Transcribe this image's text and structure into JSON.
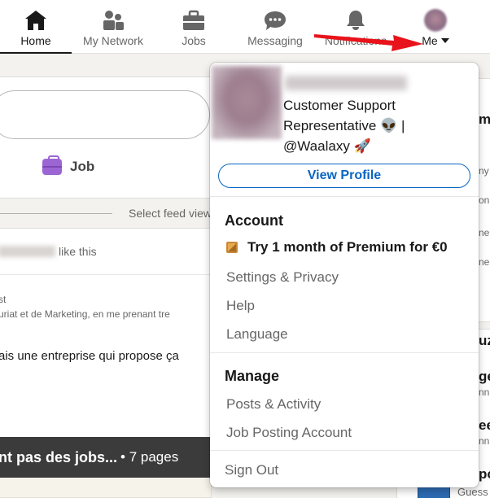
{
  "nav": {
    "items": [
      {
        "label": "Home",
        "icon": "home-icon"
      },
      {
        "label": "My Network",
        "icon": "network-icon"
      },
      {
        "label": "Jobs",
        "icon": "briefcase-icon"
      },
      {
        "label": "Messaging",
        "icon": "message-icon"
      },
      {
        "label": "Notifications",
        "icon": "bell-icon"
      }
    ],
    "me_label": "Me",
    "active": "Home"
  },
  "feed": {
    "job_label": "Job",
    "sort_label": "Select feed view",
    "liked_suffix": "like this",
    "post_meta1": "st",
    "post_meta2": "uriat et de Marketing, en me prenant tre",
    "post_text": "ais une entreprise qui propose ça",
    "doc_title": "nt pas des jobs...",
    "doc_pages": "• 7 pages"
  },
  "right_rail": {
    "lines": [
      "m",
      "ny",
      "on",
      "ne",
      "ne",
      "uz",
      "ge",
      "nn",
      "ee",
      "nn",
      "po"
    ],
    "guess": "Guess"
  },
  "dropdown": {
    "headline": "Customer Support Representative 👽 | @Waalaxy 🚀",
    "view_profile": "View Profile",
    "account_title": "Account",
    "premium": "Try 1 month of Premium for €0",
    "account_items": [
      "Settings & Privacy",
      "Help",
      "Language"
    ],
    "manage_title": "Manage",
    "manage_items": [
      "Posts & Activity",
      "Job Posting Account"
    ],
    "sign_out": "Sign Out"
  },
  "colors": {
    "accent": "#0a66c2",
    "arrow": "#e8131b",
    "premium": "#c9893b"
  }
}
